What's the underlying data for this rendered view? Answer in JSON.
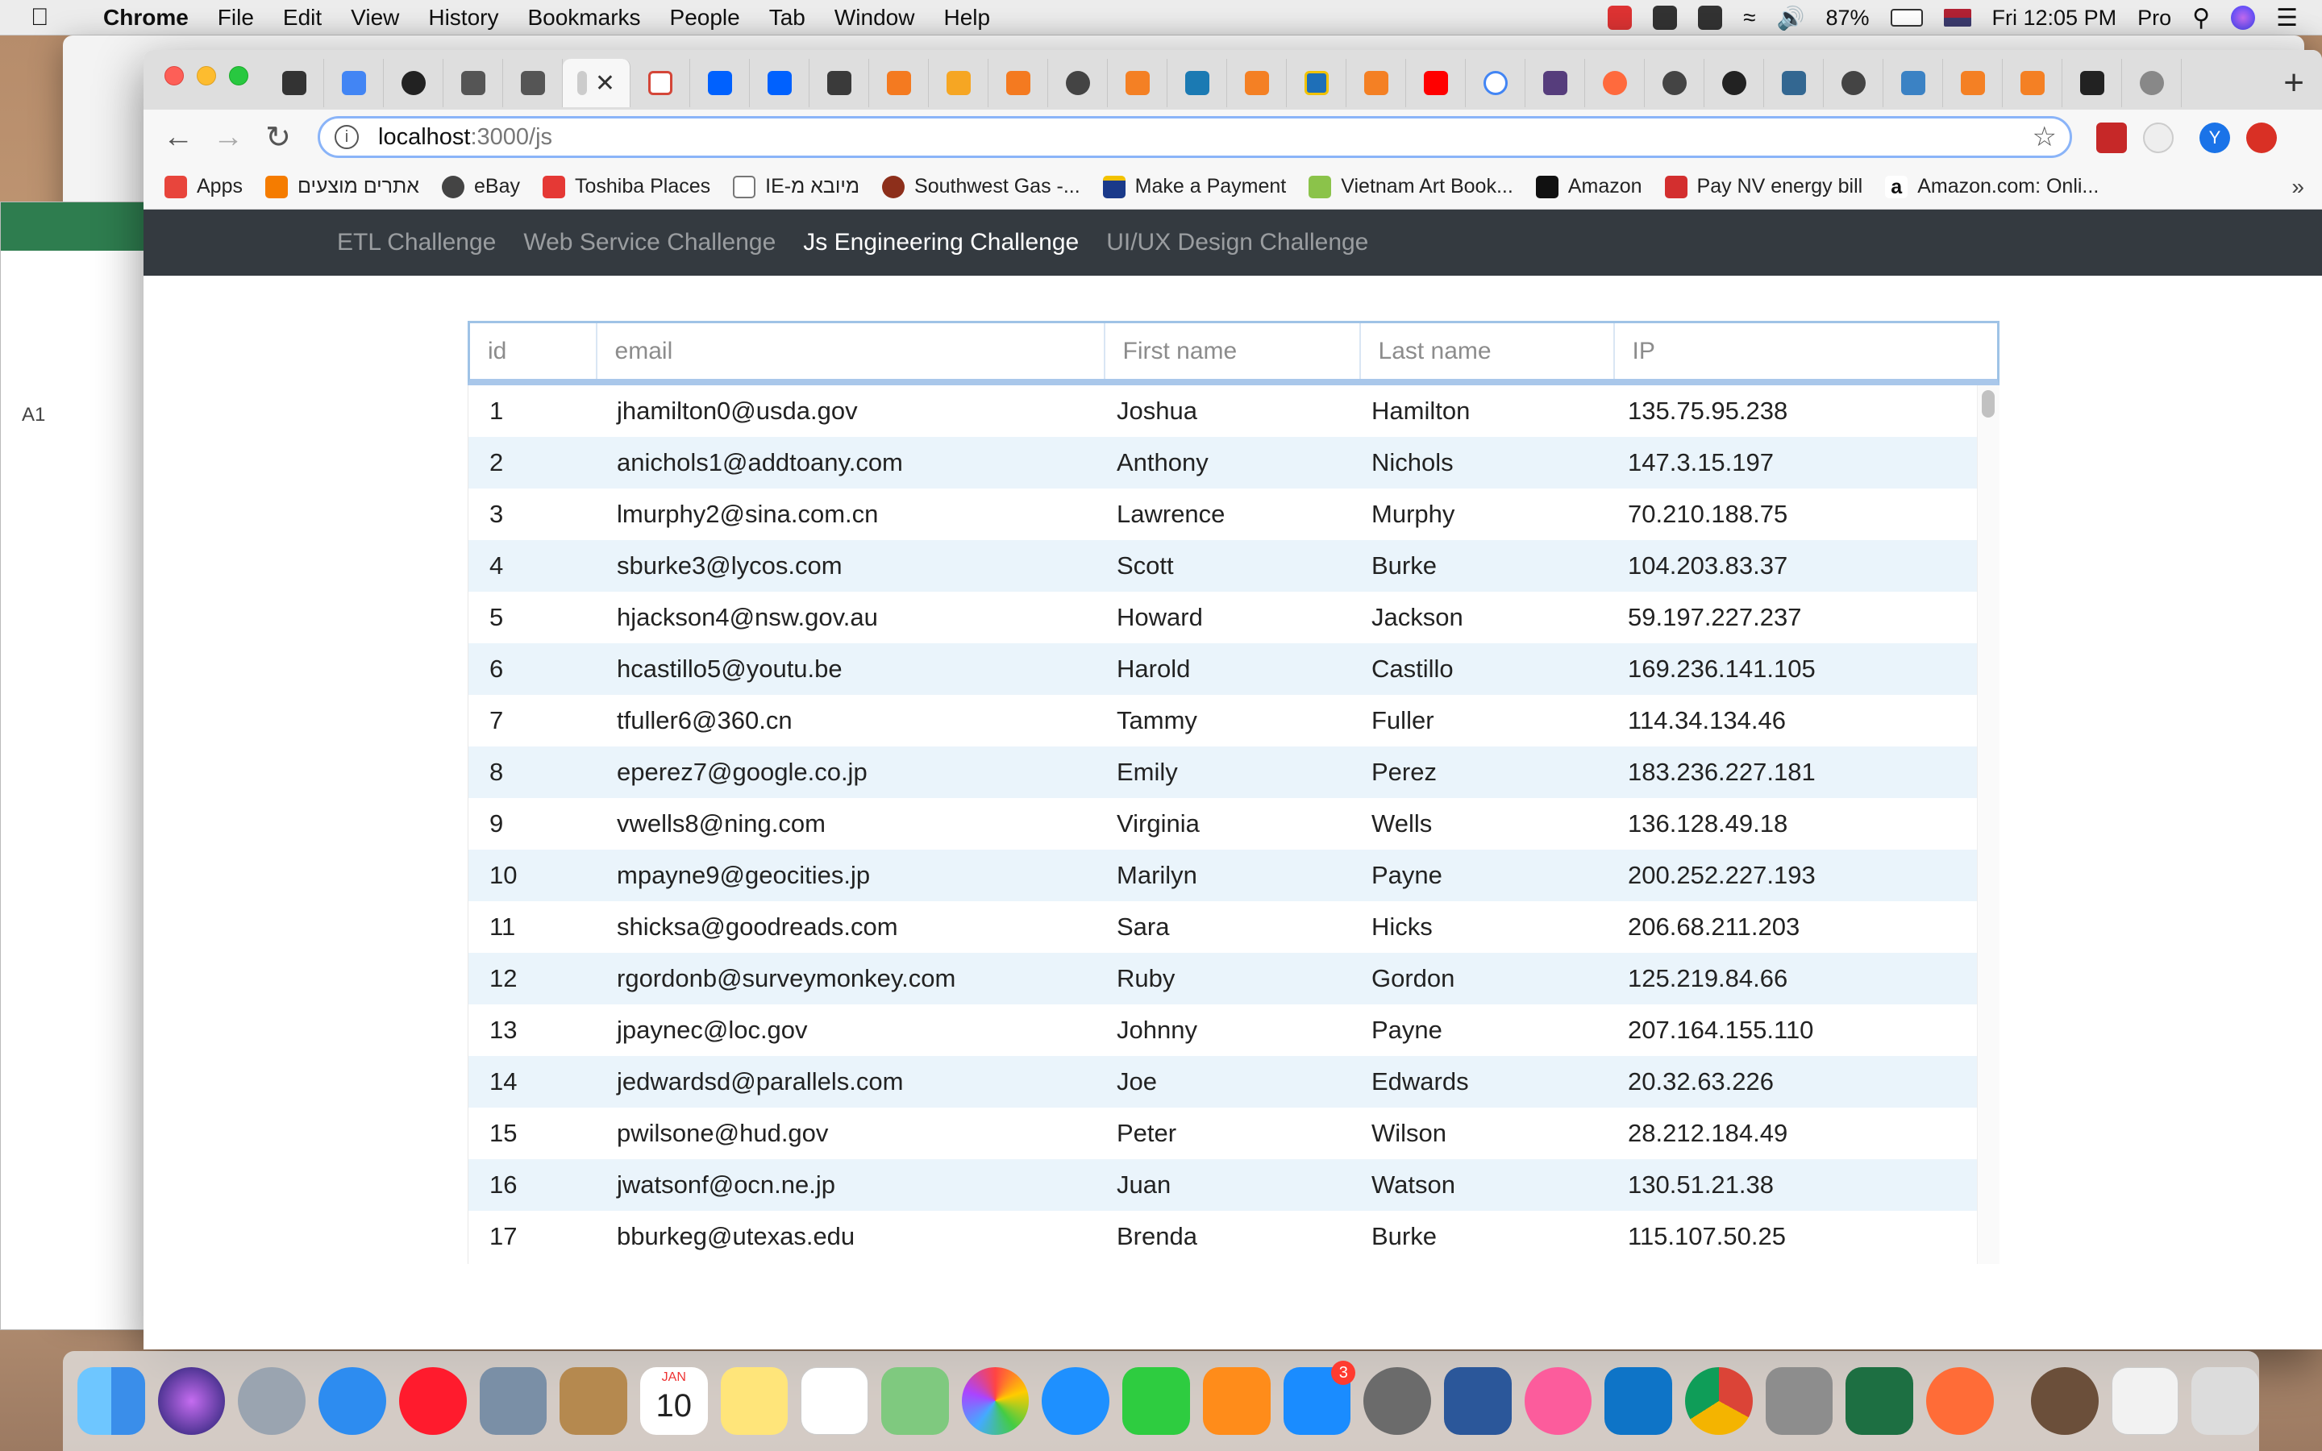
{
  "menubar": {
    "app": "Chrome",
    "items": [
      "File",
      "Edit",
      "View",
      "History",
      "Bookmarks",
      "People",
      "Tab",
      "Window",
      "Help"
    ],
    "battery": "87%",
    "clock": "Fri 12:05 PM",
    "user": "Pro"
  },
  "colors": {
    "navbar_bg": "#343a40",
    "row_alt": "#eaf4fb",
    "header_border": "#a9c7ea"
  },
  "browser": {
    "url_host": "localhost",
    "url_path": ":3000/js",
    "profile_initial": "Y",
    "bookmarks": [
      {
        "label": "Apps",
        "color": "#e8453c"
      },
      {
        "label": "אתרים מוצעים",
        "color": "#f57c00"
      },
      {
        "label": "eBay",
        "color": "#444444"
      },
      {
        "label": "Toshiba Places",
        "color": "#e53935"
      },
      {
        "label": "IE-מיובא מ",
        "color": "#777777"
      },
      {
        "label": "Southwest Gas -...",
        "color": "#8d2f1b"
      },
      {
        "label": "Make a Payment",
        "color": "#1a3a8a"
      },
      {
        "label": "Vietnam Art Book...",
        "color": "#8bc34a"
      },
      {
        "label": "Amazon",
        "color": "#111111"
      },
      {
        "label": "Pay NV energy bill",
        "color": "#d32f2f"
      },
      {
        "label": "Amazon.com: Onli...",
        "color": "#111111"
      }
    ]
  },
  "nav": {
    "links": [
      "ETL Challenge",
      "Web Service Challenge",
      "Js Engineering Challenge",
      "UI/UX Design Challenge"
    ],
    "active_index": 2
  },
  "table": {
    "headers": [
      "id",
      "email",
      "First name",
      "Last name",
      "IP"
    ],
    "rows": [
      [
        "1",
        "jhamilton0@usda.gov",
        "Joshua",
        "Hamilton",
        "135.75.95.238"
      ],
      [
        "2",
        "anichols1@addtoany.com",
        "Anthony",
        "Nichols",
        "147.3.15.197"
      ],
      [
        "3",
        "lmurphy2@sina.com.cn",
        "Lawrence",
        "Murphy",
        "70.210.188.75"
      ],
      [
        "4",
        "sburke3@lycos.com",
        "Scott",
        "Burke",
        "104.203.83.37"
      ],
      [
        "5",
        "hjackson4@nsw.gov.au",
        "Howard",
        "Jackson",
        "59.197.227.237"
      ],
      [
        "6",
        "hcastillo5@youtu.be",
        "Harold",
        "Castillo",
        "169.236.141.105"
      ],
      [
        "7",
        "tfuller6@360.cn",
        "Tammy",
        "Fuller",
        "114.34.134.46"
      ],
      [
        "8",
        "eperez7@google.co.jp",
        "Emily",
        "Perez",
        "183.236.227.181"
      ],
      [
        "9",
        "vwells8@ning.com",
        "Virginia",
        "Wells",
        "136.128.49.18"
      ],
      [
        "10",
        "mpayne9@geocities.jp",
        "Marilyn",
        "Payne",
        "200.252.227.193"
      ],
      [
        "11",
        "shicksa@goodreads.com",
        "Sara",
        "Hicks",
        "206.68.211.203"
      ],
      [
        "12",
        "rgordonb@surveymonkey.com",
        "Ruby",
        "Gordon",
        "125.219.84.66"
      ],
      [
        "13",
        "jpaynec@loc.gov",
        "Johnny",
        "Payne",
        "207.164.155.110"
      ],
      [
        "14",
        "jedwardsd@parallels.com",
        "Joe",
        "Edwards",
        "20.32.63.226"
      ],
      [
        "15",
        "pwilsone@hud.gov",
        "Peter",
        "Wilson",
        "28.212.184.49"
      ],
      [
        "16",
        "jwatsonf@ocn.ne.jp",
        "Juan",
        "Watson",
        "130.51.21.38"
      ],
      [
        "17",
        "bburkeg@utexas.edu",
        "Brenda",
        "Burke",
        "115.107.50.25"
      ]
    ]
  },
  "background_app": {
    "cell_ref": "A1"
  },
  "dock": {
    "calendar_month": "JAN",
    "calendar_day": "10",
    "appstore_badge": "3"
  }
}
